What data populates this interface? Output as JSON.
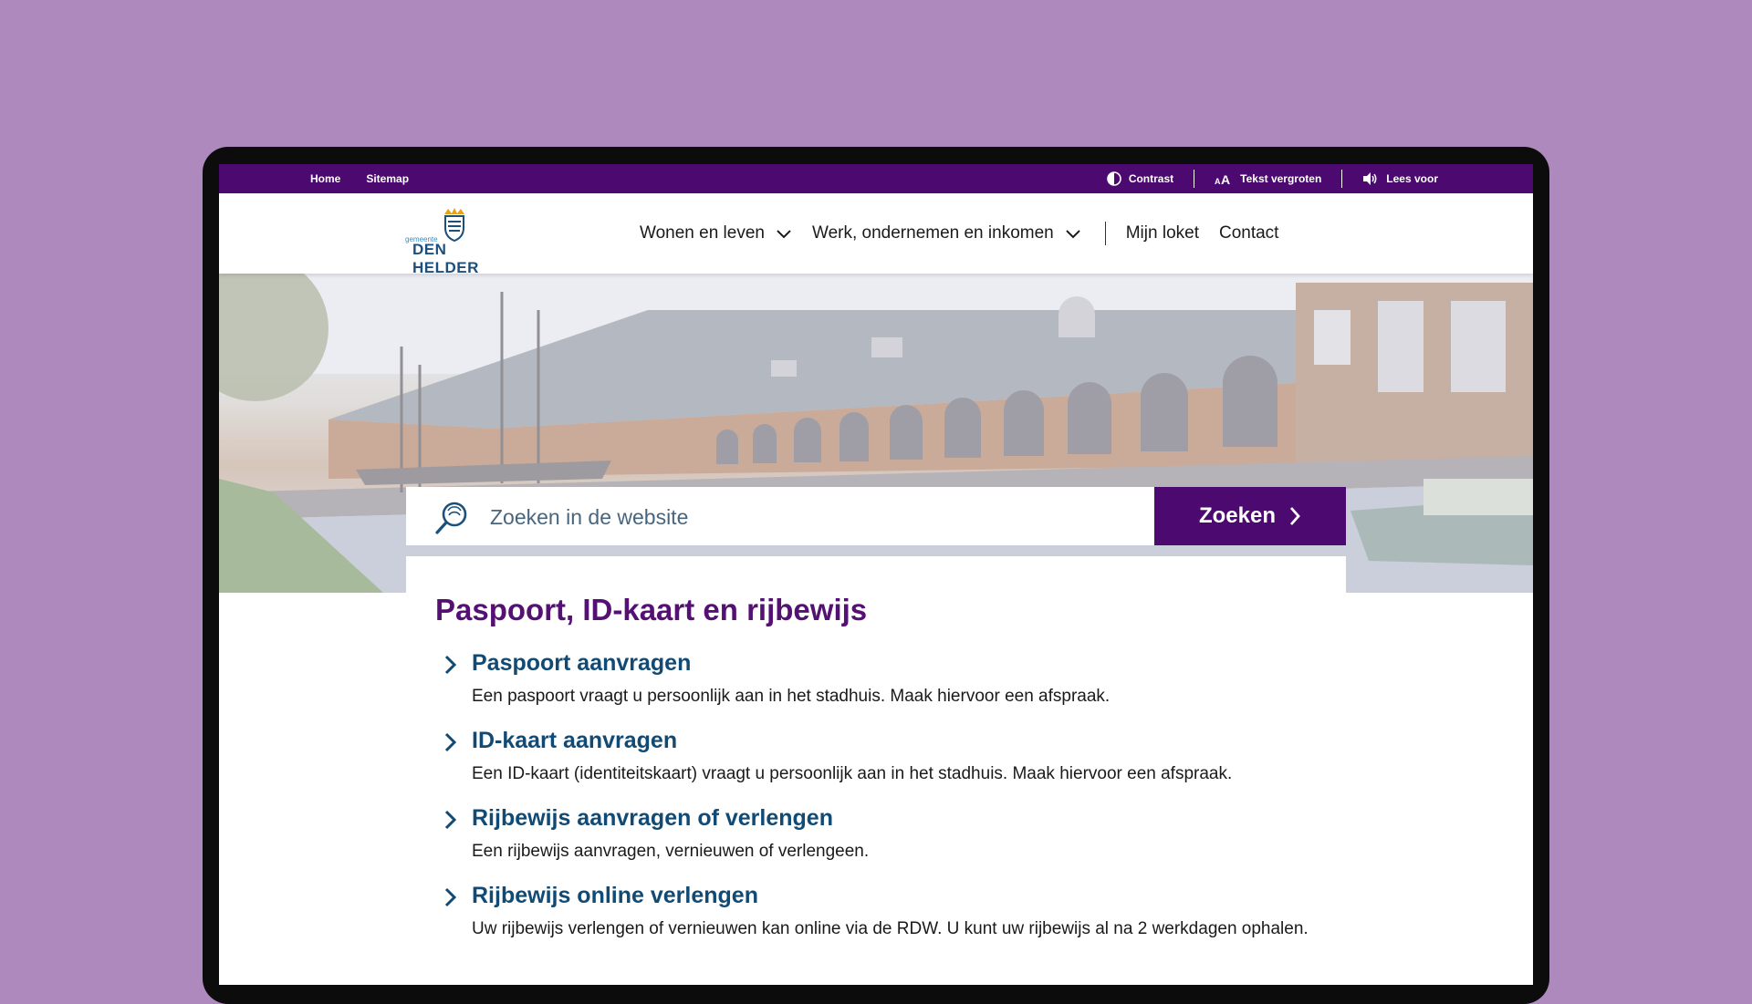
{
  "topbar": {
    "left_links": [
      "Home",
      "Sitemap"
    ],
    "contrast": "Contrast",
    "text_size": "Tekst vergroten",
    "read_aloud": "Lees voor"
  },
  "logo": {
    "small": "gemeente",
    "name": "DEN HELDER"
  },
  "nav": {
    "item1": "Wonen en leven",
    "item2": "Werk, ondernemen en inkomen",
    "item3": "Mijn loket",
    "item4": "Contact"
  },
  "search": {
    "placeholder": "Zoeken in de website",
    "button": "Zoeken"
  },
  "main": {
    "title": "Paspoort, ID-kaart en rijbewijs",
    "links": [
      {
        "title": "Paspoort aanvragen",
        "desc": "Een paspoort vraagt u persoonlijk aan in het stadhuis. Maak hiervoor een afspraak."
      },
      {
        "title": "ID-kaart aanvragen",
        "desc": "Een ID-kaart (identiteitskaart) vraagt u persoonlijk aan in het stadhuis. Maak hiervoor een afspraak."
      },
      {
        "title": "Rijbewijs aanvragen of verlengen",
        "desc": "Een rijbewijs aanvragen, vernieuwen of verlengeen."
      },
      {
        "title": "Rijbewijs online verlengen",
        "desc": "Uw rijbewijs verlengen of vernieuwen kan online via de RDW. U kunt uw rijbewijs al na 2 werkdagen ophalen."
      }
    ]
  },
  "colors": {
    "brand_purple": "#4c0a70",
    "title_purple": "#551073",
    "link_blue": "#114a74",
    "backdrop": "#ad89bd"
  }
}
